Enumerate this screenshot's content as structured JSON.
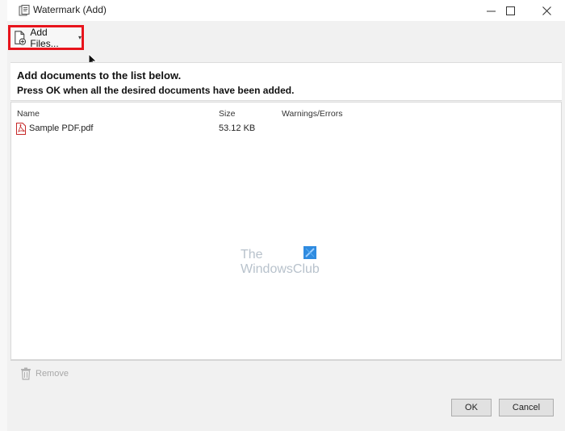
{
  "window": {
    "title": "Watermark (Add)"
  },
  "toolbar": {
    "add_files_label": "Add Files...",
    "add_files_caret": "▾"
  },
  "instructions": {
    "line1": "Add documents to the list below.",
    "line2": "Press OK when all the desired documents have been added."
  },
  "file_list": {
    "columns": [
      "Name",
      "Size",
      "Warnings/Errors"
    ],
    "rows": [
      {
        "name": "Sample PDF.pdf",
        "size": "53.12 KB",
        "warnings": ""
      }
    ]
  },
  "watermark": {
    "line1": "The",
    "line2": "WindowsClub"
  },
  "bottom": {
    "remove_label": "Remove"
  },
  "dialog_buttons": {
    "ok_label": "OK",
    "cancel_label": "Cancel"
  },
  "colors": {
    "highlight_border": "#e8141c",
    "window_bg": "#f1f1f1",
    "panel_bg": "#ffffff",
    "watermark_text": "#b8c2cc",
    "watermark_logo": "#2f8be0"
  }
}
